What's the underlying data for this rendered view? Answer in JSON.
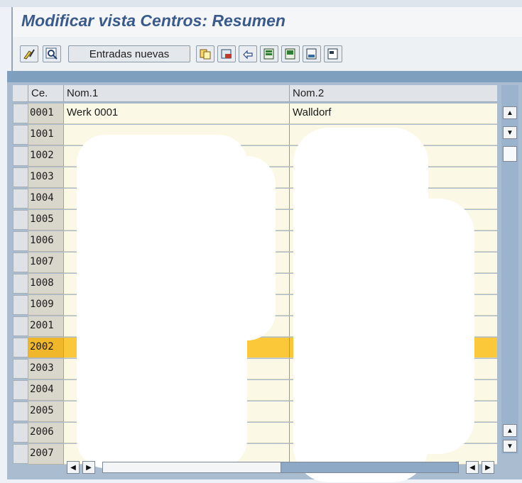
{
  "window": {
    "title": "Modificar vista Centros: Resumen"
  },
  "toolbar": {
    "new_entries_label": "Entradas nuevas",
    "icons": [
      "edit-display-icon",
      "find-icon",
      "copy-icon",
      "delete-icon",
      "undo-icon",
      "select-all-icon",
      "select-block-icon",
      "deselect-all-icon",
      "details-icon"
    ]
  },
  "table": {
    "headers": {
      "ce": "Ce.",
      "nom1": "Nom.1",
      "nom2": "Nom.2"
    },
    "rows": [
      {
        "ce": "0001",
        "nom1": "Werk 0001",
        "nom2": "Walldorf"
      },
      {
        "ce": "1001",
        "nom1": "",
        "nom2": ""
      },
      {
        "ce": "1002",
        "nom1": "",
        "nom2": ""
      },
      {
        "ce": "1003",
        "nom1": "",
        "nom2": ""
      },
      {
        "ce": "1004",
        "nom1": "",
        "nom2": ""
      },
      {
        "ce": "1005",
        "nom1": "",
        "nom2": ""
      },
      {
        "ce": "1006",
        "nom1": "",
        "nom2": ""
      },
      {
        "ce": "1007",
        "nom1": "",
        "nom2": ""
      },
      {
        "ce": "1008",
        "nom1": "",
        "nom2": ""
      },
      {
        "ce": "1009",
        "nom1": "",
        "nom2": ""
      },
      {
        "ce": "2001",
        "nom1": "",
        "nom2": ""
      },
      {
        "ce": "2002",
        "nom1": "",
        "nom2": ""
      },
      {
        "ce": "2003",
        "nom1": "",
        "nom2": ""
      },
      {
        "ce": "2004",
        "nom1": "",
        "nom2": ""
      },
      {
        "ce": "2005",
        "nom1": "",
        "nom2": ""
      },
      {
        "ce": "2006",
        "nom1": "",
        "nom2": ""
      },
      {
        "ce": "2007",
        "nom1": "",
        "nom2": ""
      }
    ],
    "highlighted_row": "2002"
  },
  "colors": {
    "title": "#3b5a8c",
    "highlight": "#fbc83a",
    "row_bg": "#fbf8e6"
  }
}
